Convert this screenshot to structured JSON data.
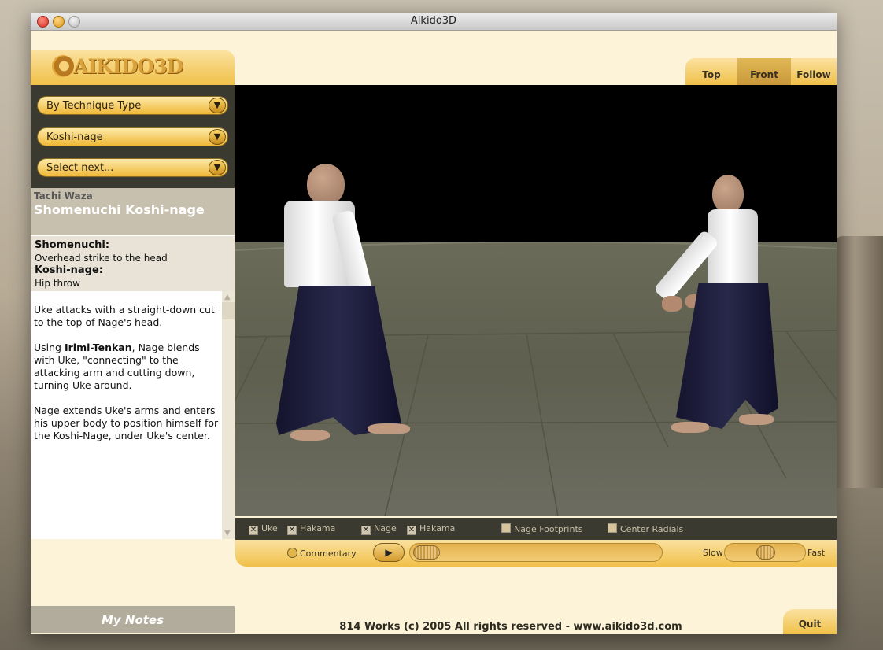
{
  "window": {
    "title": "Aikido3D"
  },
  "logo": {
    "text": "AIKIDO3D"
  },
  "selectors": [
    {
      "label": "By Technique Type"
    },
    {
      "label": "Koshi-nage"
    },
    {
      "label": "Select next..."
    }
  ],
  "technique": {
    "category": "Tachi Waza",
    "name": "Shomenuchi Koshi-nage",
    "definitions": [
      {
        "term": "Shomenuchi:",
        "meaning": "Overhead strike to the head"
      },
      {
        "term": "Koshi-nage:",
        "meaning": "Hip throw"
      }
    ],
    "description": {
      "p1": "Uke attacks with a straight-down cut to the top of Nage's head.",
      "p2_pre": "Using ",
      "p2_bold": "Irimi-Tenkan",
      "p2_post": ", Nage blends with Uke, \"connecting\" to the attacking arm and cutting down, turning Uke around.",
      "p3": "Nage extends Uke's arms and enters his upper body to position himself for the Koshi-Nage, under Uke's center."
    }
  },
  "view_tabs": {
    "top": "Top",
    "front": "Front",
    "follow": "Follow",
    "active": "Front"
  },
  "toggles": [
    {
      "label": "Uke",
      "checked": true
    },
    {
      "label": "Hakama",
      "checked": true
    },
    {
      "label": "Nage",
      "checked": true
    },
    {
      "label": "Hakama",
      "checked": true
    },
    {
      "label": "Nage Footprints",
      "checked": false
    },
    {
      "label": "Center Radials",
      "checked": false
    }
  ],
  "playback": {
    "commentary": "Commentary",
    "play_icon": "play-icon",
    "slow": "Slow",
    "fast": "Fast"
  },
  "notes": {
    "label": "My  Notes"
  },
  "footer": {
    "text": "814 Works (c) 2005 All rights reserved - www.aikido3d.com"
  },
  "quit": {
    "label": "Quit"
  },
  "colors": {
    "accent": "#f0c048",
    "panel_dark": "#3a3a30",
    "background": "#fdf3d8"
  }
}
